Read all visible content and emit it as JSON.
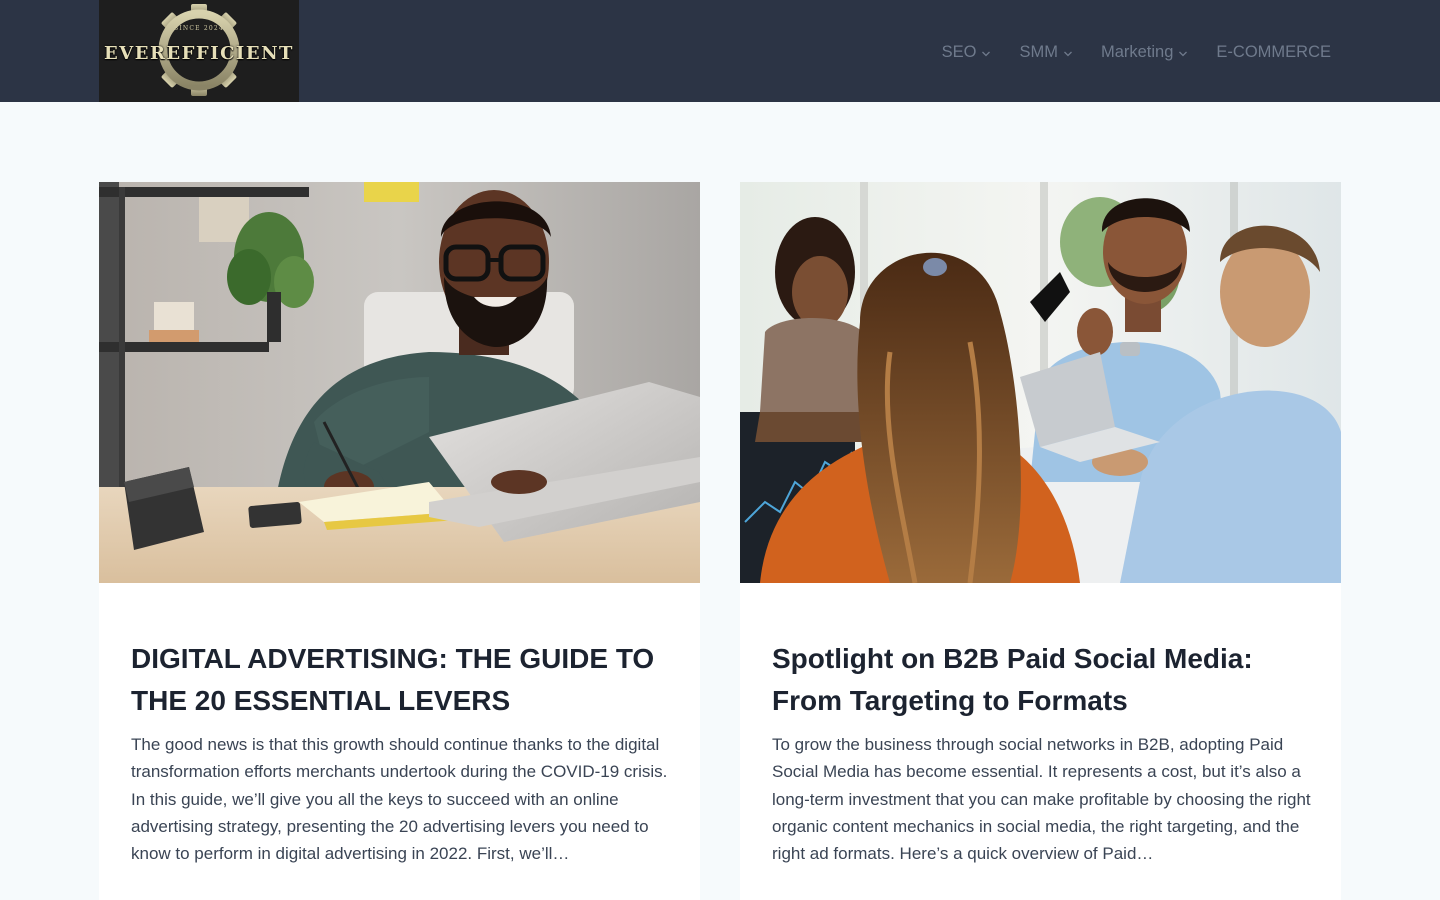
{
  "header": {
    "logo_text": "EVEREFFICIENT",
    "logo_tagline": "SINCE 2024",
    "nav": [
      {
        "label": "SEO",
        "has_dropdown": true
      },
      {
        "label": "SMM",
        "has_dropdown": true
      },
      {
        "label": "Marketing",
        "has_dropdown": true
      },
      {
        "label": "E-COMMERCE",
        "has_dropdown": false
      }
    ]
  },
  "posts": [
    {
      "title": "DIGITAL ADVERTISING: THE GUIDE TO THE 20 ESSENTIAL LEVERS",
      "excerpt": "The good news is that this growth should continue thanks to the digital transformation efforts merchants undertook during the COVID-19 crisis. In this guide, we’ll give you all the keys to succeed with an online advertising strategy, presenting the 20 advertising levers you need to know to perform in digital advertising in 2022. First, we’ll…"
    },
    {
      "title": "Spotlight on B2B Paid Social Media: From Targeting to Formats",
      "excerpt": "To grow the business through social networks in B2B, adopting Paid Social Media has become essential. It represents a cost, but it’s also a long-term investment that you can make profitable by choosing the right organic content mechanics in social media, the right targeting, and the right ad formats. Here’s a quick overview of Paid…"
    }
  ],
  "colors": {
    "header_bg": "#2c3445",
    "page_bg": "#f6fafc",
    "nav_text": "#6f7a8c",
    "title_text": "#1c2330",
    "body_text": "#3a4454"
  }
}
